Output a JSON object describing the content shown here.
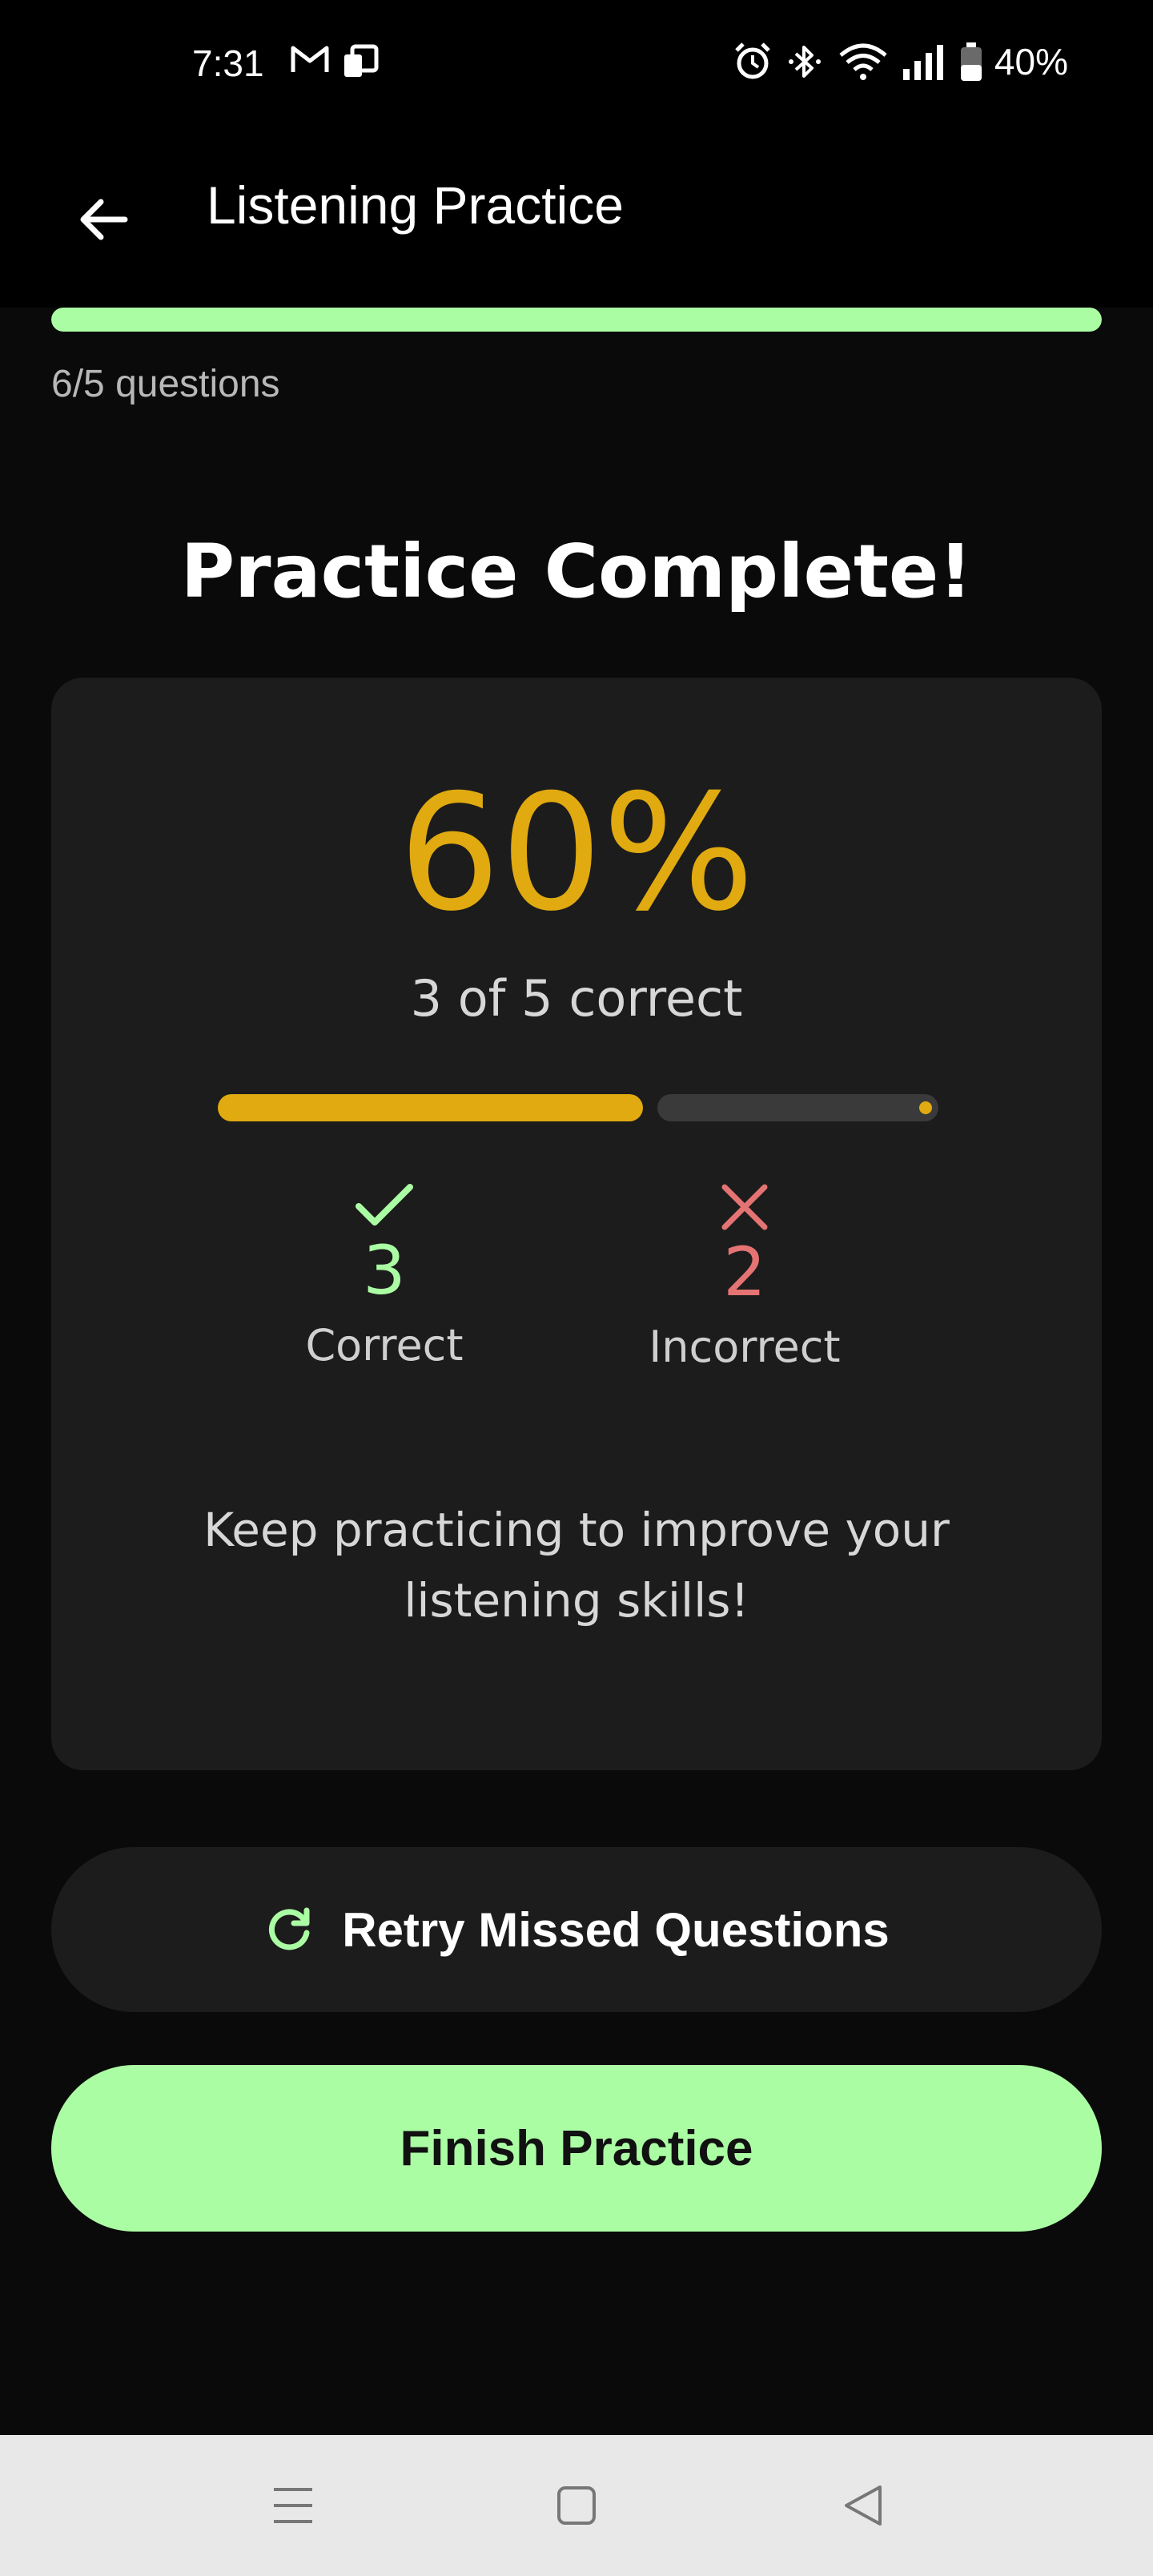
{
  "status_bar": {
    "time": "7:31",
    "battery": "40%",
    "icons_left": [
      "gmail-icon",
      "device-icon"
    ],
    "icons_right": [
      "alarm-icon",
      "bluetooth-icon",
      "wifi-icon",
      "signal-icon",
      "battery-icon"
    ]
  },
  "app_bar": {
    "title": "Listening Practice",
    "back_icon": "arrow-left-icon"
  },
  "progress": {
    "label": "6/5 questions",
    "fraction": 1.0,
    "color": "#abfda4"
  },
  "result": {
    "title": "Practice Complete!",
    "percentage": "60%",
    "summary": "3 of 5 correct",
    "correct_fraction": 0.6,
    "accent_color": "#e0aa10",
    "correct": {
      "count": "3",
      "label": "Correct",
      "icon": "check-icon",
      "color": "#abfda4"
    },
    "incorrect": {
      "count": "2",
      "label": "Incorrect",
      "icon": "close-icon",
      "color": "#e57373"
    },
    "message": "Keep practicing to improve your listening skills!"
  },
  "actions": {
    "retry_label": "Retry Missed Questions",
    "retry_icon": "refresh-icon",
    "finish_label": "Finish Practice"
  },
  "nav": {
    "items": [
      "menu-icon",
      "home-icon",
      "back-icon"
    ]
  }
}
